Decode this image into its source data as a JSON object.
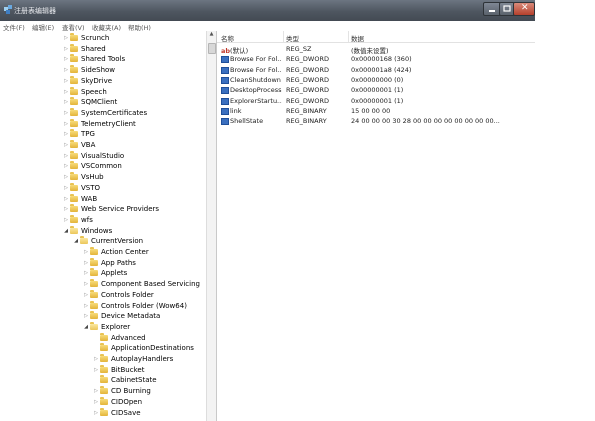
{
  "window": {
    "title": "注册表编辑器",
    "colors": {
      "titlebar": "#4e5660",
      "close": "#b4402c",
      "folder": "#e3b43a"
    }
  },
  "menu": [
    "文件(F)",
    "编辑(E)",
    "查看(V)",
    "收藏夹(A)",
    "帮助(H)"
  ],
  "tree": [
    {
      "label": "Scrunch",
      "depth": 0,
      "expanded": false
    },
    {
      "label": "Shared",
      "depth": 0,
      "expanded": false
    },
    {
      "label": "Shared Tools",
      "depth": 0,
      "expanded": false
    },
    {
      "label": "SideShow",
      "depth": 0,
      "expanded": false
    },
    {
      "label": "SkyDrive",
      "depth": 0,
      "expanded": false
    },
    {
      "label": "Speech",
      "depth": 0,
      "expanded": false
    },
    {
      "label": "SQMClient",
      "depth": 0,
      "expanded": false
    },
    {
      "label": "SystemCertificates",
      "depth": 0,
      "expanded": false
    },
    {
      "label": "TelemetryClient",
      "depth": 0,
      "expanded": false
    },
    {
      "label": "TPG",
      "depth": 0,
      "expanded": false
    },
    {
      "label": "VBA",
      "depth": 0,
      "expanded": false
    },
    {
      "label": "VisualStudio",
      "depth": 0,
      "expanded": false
    },
    {
      "label": "VSCommon",
      "depth": 0,
      "expanded": false
    },
    {
      "label": "VsHub",
      "depth": 0,
      "expanded": false
    },
    {
      "label": "VSTO",
      "depth": 0,
      "expanded": false
    },
    {
      "label": "WAB",
      "depth": 0,
      "expanded": false
    },
    {
      "label": "Web Service Providers",
      "depth": 0,
      "expanded": false
    },
    {
      "label": "wfs",
      "depth": 0,
      "expanded": false
    },
    {
      "label": "Windows",
      "depth": 0,
      "expanded": true
    },
    {
      "label": "CurrentVersion",
      "depth": 1,
      "expanded": true
    },
    {
      "label": "Action Center",
      "depth": 2,
      "expanded": false
    },
    {
      "label": "App Paths",
      "depth": 2,
      "expanded": false
    },
    {
      "label": "Applets",
      "depth": 2,
      "expanded": false
    },
    {
      "label": "Component Based Servicing",
      "depth": 2,
      "expanded": false
    },
    {
      "label": "Controls Folder",
      "depth": 2,
      "expanded": false
    },
    {
      "label": "Controls Folder (Wow64)",
      "depth": 2,
      "expanded": false
    },
    {
      "label": "Device Metadata",
      "depth": 2,
      "expanded": false
    },
    {
      "label": "Explorer",
      "depth": 2,
      "expanded": true,
      "selected": true
    },
    {
      "label": "Advanced",
      "depth": 3,
      "expanded": false,
      "leaf": true
    },
    {
      "label": "ApplicationDestinations",
      "depth": 3,
      "expanded": false,
      "leaf": true
    },
    {
      "label": "AutoplayHandlers",
      "depth": 3,
      "expanded": false
    },
    {
      "label": "BitBucket",
      "depth": 3,
      "expanded": false
    },
    {
      "label": "CabinetState",
      "depth": 3,
      "expanded": false,
      "leaf": true
    },
    {
      "label": "CD Burning",
      "depth": 3,
      "expanded": false
    },
    {
      "label": "CIDOpen",
      "depth": 3,
      "expanded": false
    },
    {
      "label": "CIDSave",
      "depth": 3,
      "expanded": false
    }
  ],
  "list": {
    "columns": {
      "name": "名称",
      "type": "类型",
      "data": "数据"
    },
    "rows": [
      {
        "icon": "string-value-icon",
        "name": "ab(默认)",
        "type": "REG_SZ",
        "data": "(数值未设置)"
      },
      {
        "icon": "binary-value-icon",
        "name": "Browse For Fol...",
        "type": "REG_DWORD",
        "data": "0x00000168 (360)"
      },
      {
        "icon": "binary-value-icon",
        "name": "Browse For Fol...",
        "type": "REG_DWORD",
        "data": "0x000001a8 (424)"
      },
      {
        "icon": "binary-value-icon",
        "name": "CleanShutdown",
        "type": "REG_DWORD",
        "data": "0x00000000 (0)"
      },
      {
        "icon": "binary-value-icon",
        "name": "DesktopProcess",
        "type": "REG_DWORD",
        "data": "0x00000001 (1)"
      },
      {
        "icon": "binary-value-icon",
        "name": "ExplorerStartu...",
        "type": "REG_DWORD",
        "data": "0x00000001 (1)"
      },
      {
        "icon": "binary-value-icon",
        "name": "link",
        "type": "REG_BINARY",
        "data": "15 00 00 00"
      },
      {
        "icon": "binary-value-icon",
        "name": "ShellState",
        "type": "REG_BINARY",
        "data": "24 00 00 00 30 28 00 00 00 00 00 00 00 00..."
      }
    ]
  }
}
